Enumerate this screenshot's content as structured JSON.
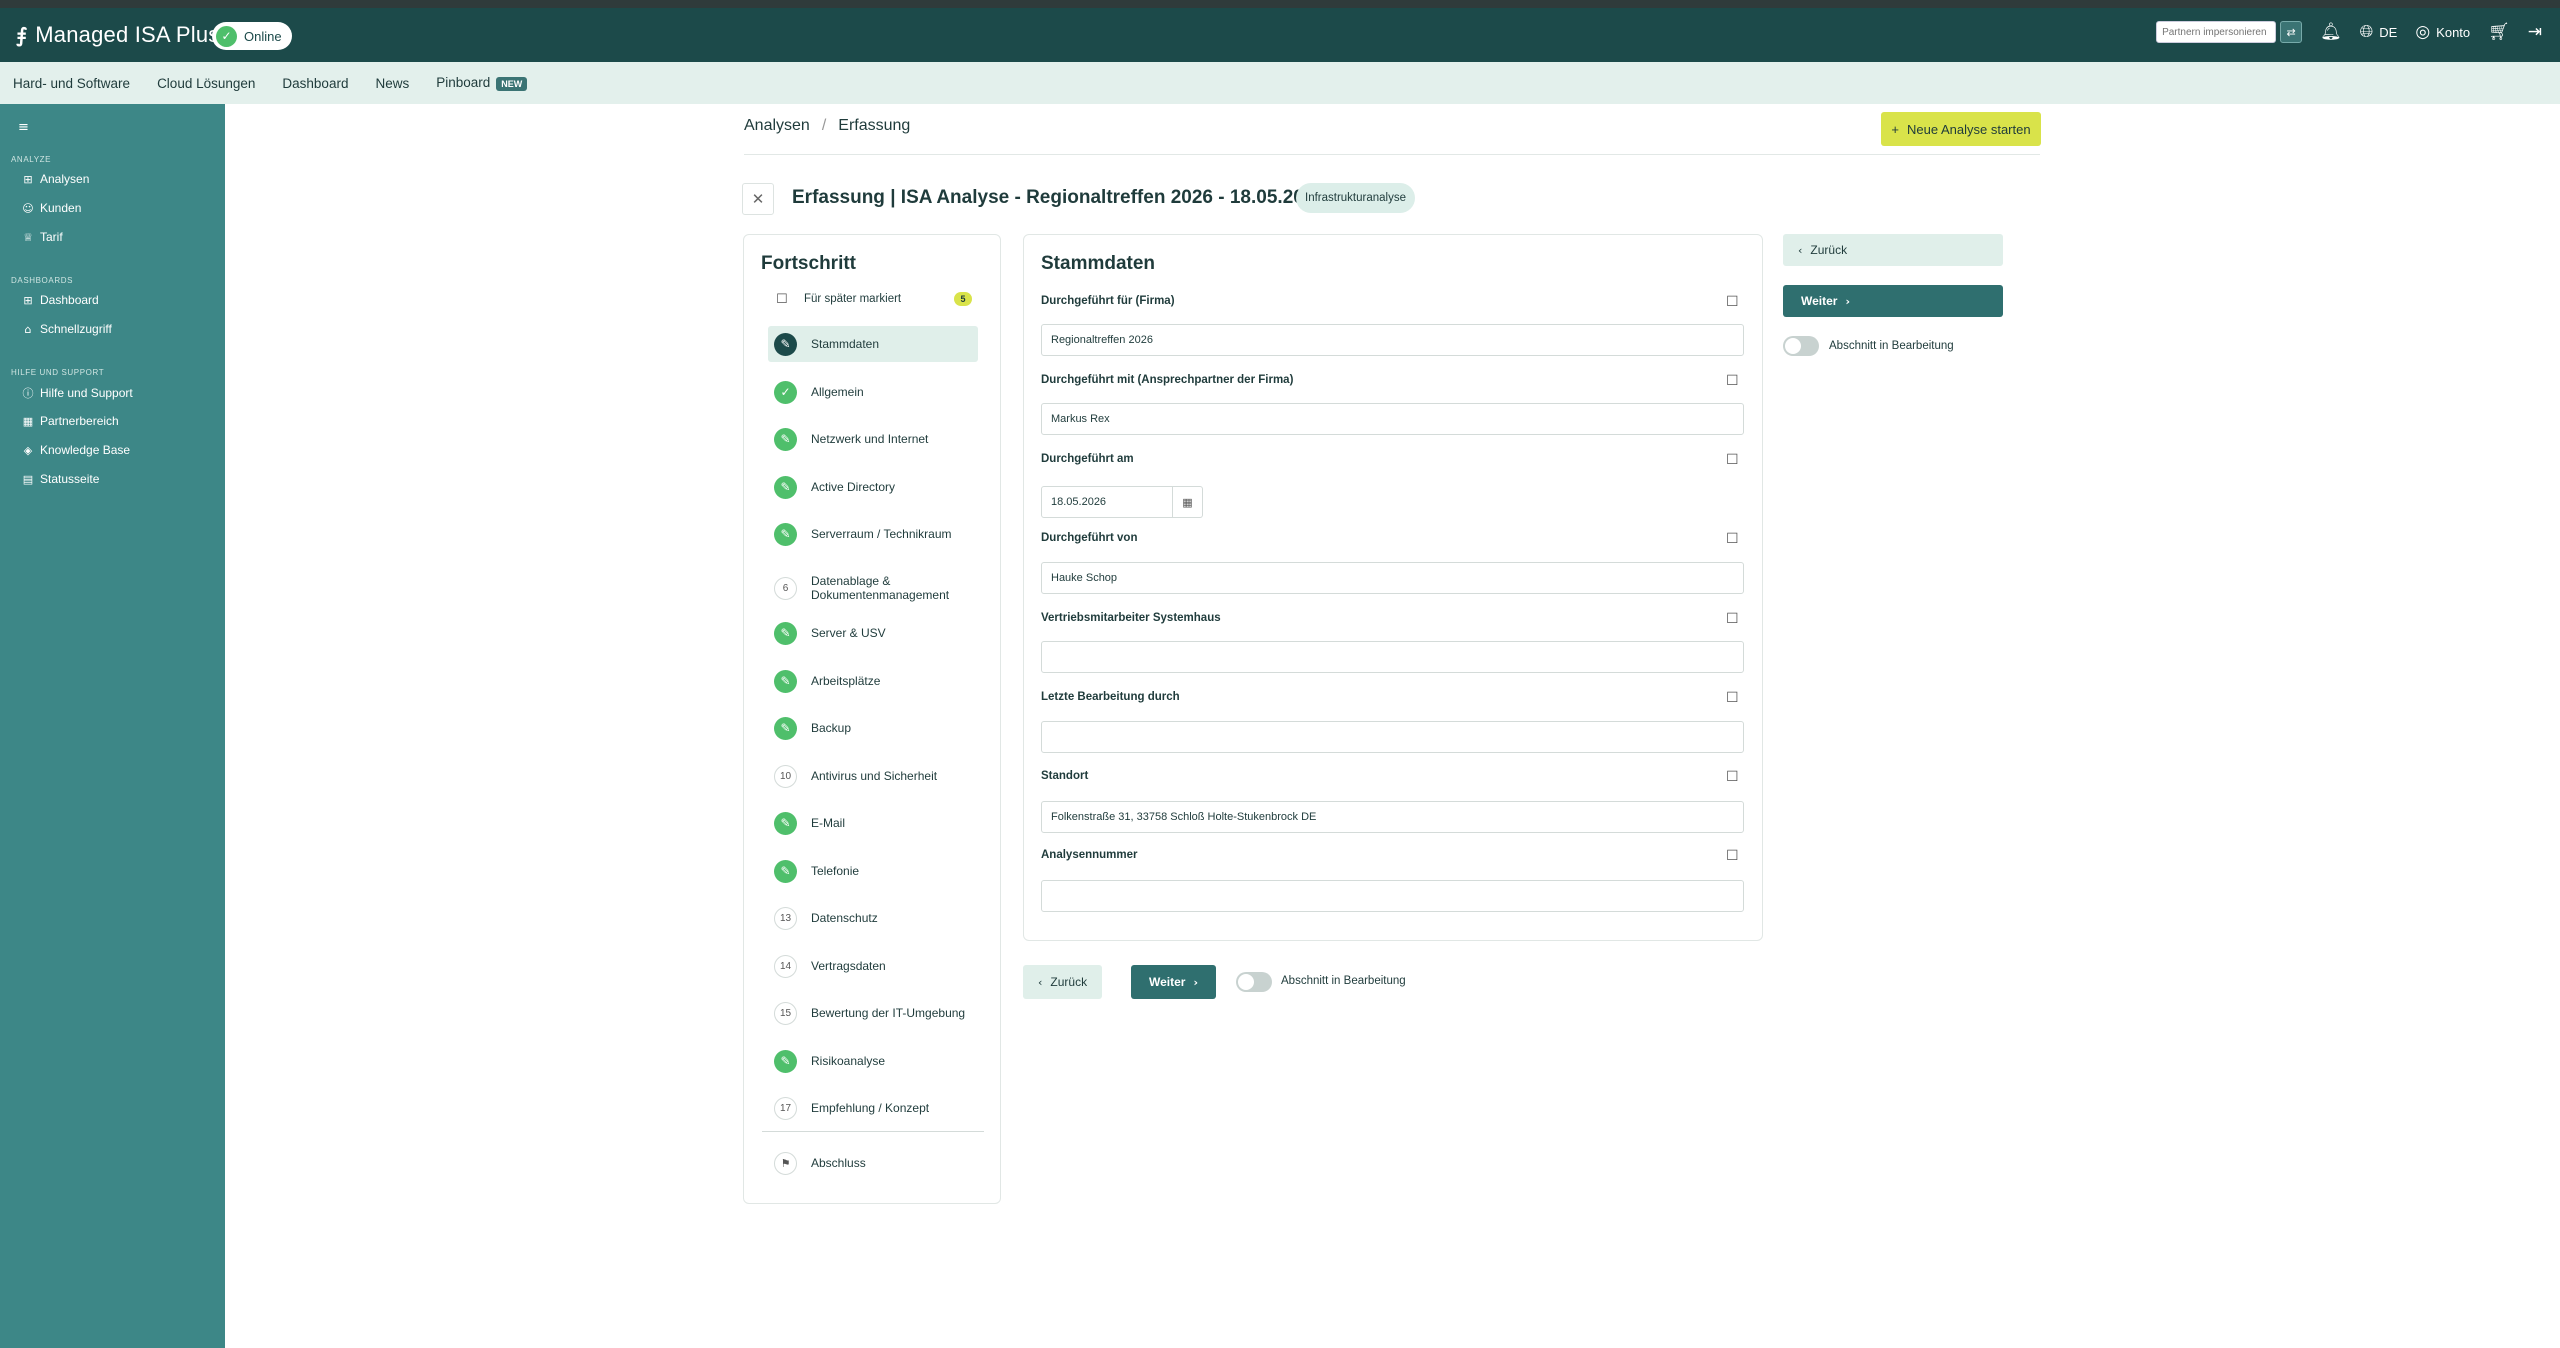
{
  "app": {
    "title": "Managed ISA Plus",
    "status": "Online",
    "impersonate_placeholder": "Partnern impersonieren",
    "lang": "DE",
    "account": "Konto"
  },
  "nav": {
    "items": [
      "Hard- und Software",
      "Cloud Lösungen",
      "Dashboard",
      "News",
      "Pinboard"
    ],
    "pinboard_badge": "NEW"
  },
  "sidebar": {
    "sections": [
      {
        "title": "ANALYZE",
        "items": [
          {
            "label": "Analysen",
            "icon": "grid-icon"
          },
          {
            "label": "Kunden",
            "icon": "users-icon"
          },
          {
            "label": "Tarif",
            "icon": "crown-icon"
          }
        ]
      },
      {
        "title": "DASHBOARDS",
        "items": [
          {
            "label": "Dashboard",
            "icon": "dashboard-icon"
          },
          {
            "label": "Schnellzugriff",
            "icon": "home-icon"
          }
        ]
      },
      {
        "title": "HILFE UND SUPPORT",
        "items": [
          {
            "label": "Hilfe und Support",
            "icon": "help-icon"
          },
          {
            "label": "Partnerbereich",
            "icon": "building-icon"
          },
          {
            "label": "Knowledge Base",
            "icon": "layers-icon"
          },
          {
            "label": "Statusseite",
            "icon": "document-icon"
          }
        ]
      }
    ]
  },
  "breadcrumb": {
    "items": [
      "Analysen",
      "Erfassung"
    ],
    "separator": "/"
  },
  "new_analysis_button": "Neue Analyse starten",
  "page": {
    "title": "Erfassung | ISA Analyse - Regionaltreffen 2026 - 18.05.2026",
    "type_badge": "Infrastrukturanalyse"
  },
  "progress": {
    "title": "Fortschritt",
    "marked_label": "Für später markiert",
    "marked_count": "5",
    "steps": [
      {
        "label": "Stammdaten",
        "state": "current",
        "num": ""
      },
      {
        "label": "Allgemein",
        "state": "done",
        "num": ""
      },
      {
        "label": "Netzwerk und Internet",
        "state": "done",
        "num": ""
      },
      {
        "label": "Active Directory",
        "state": "done",
        "num": ""
      },
      {
        "label": "Serverraum / Technikraum",
        "state": "done",
        "num": ""
      },
      {
        "label": "Datenablage & Dokumentenmanagement",
        "state": "todo",
        "num": "6"
      },
      {
        "label": "Server & USV",
        "state": "done",
        "num": ""
      },
      {
        "label": "Arbeitsplätze",
        "state": "done",
        "num": ""
      },
      {
        "label": "Backup",
        "state": "done",
        "num": ""
      },
      {
        "label": "Antivirus und Sicherheit",
        "state": "todo",
        "num": "10"
      },
      {
        "label": "E-Mail",
        "state": "done",
        "num": ""
      },
      {
        "label": "Telefonie",
        "state": "done",
        "num": ""
      },
      {
        "label": "Datenschutz",
        "state": "todo",
        "num": "13"
      },
      {
        "label": "Vertragsdaten",
        "state": "todo",
        "num": "14"
      },
      {
        "label": "Bewertung der IT-Umgebung",
        "state": "todo",
        "num": "15"
      },
      {
        "label": "Risikoanalyse",
        "state": "done",
        "num": ""
      },
      {
        "label": "Empfehlung / Konzept",
        "state": "todo",
        "num": "17"
      }
    ],
    "final_step": "Abschluss"
  },
  "form": {
    "title": "Stammdaten",
    "fields": [
      {
        "label": "Durchgeführt für (Firma)",
        "value": "Regionaltreffen 2026"
      },
      {
        "label": "Durchgeführt mit (Ansprechpartner der Firma)",
        "value": "Markus Rex"
      },
      {
        "label": "Durchgeführt am",
        "value": "18.05.2026"
      },
      {
        "label": "Durchgeführt von",
        "value": "Hauke Schop"
      },
      {
        "label": "Vertriebsmitarbeiter Systemhaus",
        "value": ""
      },
      {
        "label": "Letzte Bearbeitung durch",
        "value": ""
      },
      {
        "label": "Standort",
        "value": "Folkenstraße 31, 33758 Schloß Holte-Stukenbrock DE"
      },
      {
        "label": "Analysennummer",
        "value": ""
      }
    ]
  },
  "actions": {
    "back": "Zurück",
    "next": "Weiter",
    "toggle_label": "Abschnitt in Bearbeitung"
  },
  "colors": {
    "header": "#1c4a4a",
    "sidebar": "#3d8787",
    "nav": "#e3f0ec",
    "accent": "#d9e34a",
    "done": "#4fbf6b",
    "primary_button": "#2f6f6f"
  }
}
